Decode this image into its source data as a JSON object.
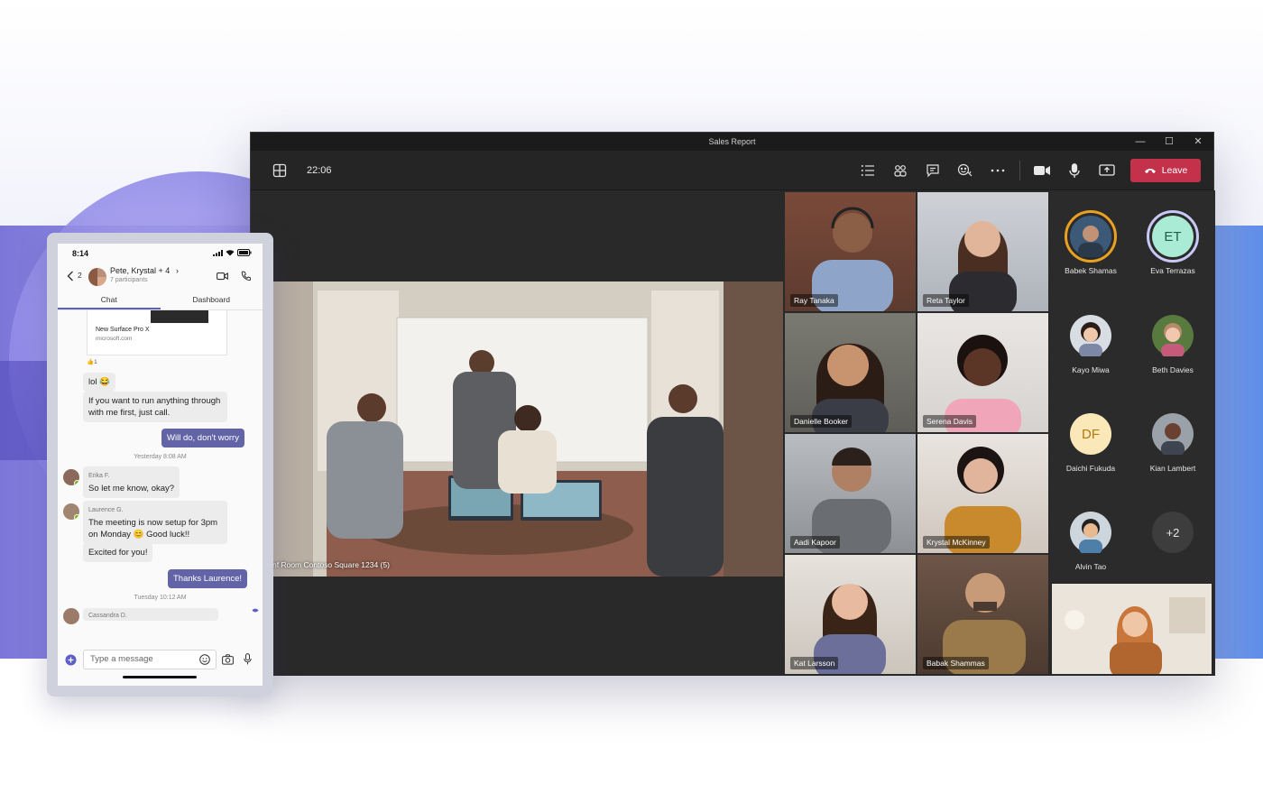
{
  "window": {
    "title": "Sales Report",
    "controls": {
      "minimize": "—",
      "maximize": "☐",
      "close": "✕"
    }
  },
  "toolbar": {
    "time": "22:06",
    "leave_label": "Leave",
    "leave_color": "#c4314b",
    "icons": [
      "grid-layout-icon",
      "participants-list-icon",
      "people-icon",
      "chat-icon",
      "reactions-icon",
      "more-options-icon",
      "camera-icon",
      "microphone-icon",
      "share-screen-icon",
      "phone-hangup-icon"
    ]
  },
  "main_video": {
    "caption": "nf Room Contoso Square 1234 (5)"
  },
  "tiles": [
    {
      "name": "Ray Tanaka"
    },
    {
      "name": "Reta Taylor"
    },
    {
      "name": "Danielle Booker"
    },
    {
      "name": "Serena Davis"
    },
    {
      "name": "Aadi Kapoor"
    },
    {
      "name": "Krystal McKinney"
    },
    {
      "name": "Kat Larsson"
    },
    {
      "name": "Babak Shammas"
    }
  ],
  "roster": [
    {
      "name": "Babek Shamas",
      "initials": "",
      "ring_color": "#e8a123"
    },
    {
      "name": "Eva Terrazas",
      "initials": "ET",
      "ring_color": "#c7c8f5"
    },
    {
      "name": "Kayo Miwa",
      "initials": ""
    },
    {
      "name": "Beth Davies",
      "initials": ""
    },
    {
      "name": "Daichi Fukuda",
      "initials": "DF"
    },
    {
      "name": "Kian Lambert",
      "initials": ""
    },
    {
      "name": "Alvin Tao",
      "initials": ""
    },
    {
      "name": "",
      "initials": "+2"
    }
  ],
  "phone": {
    "status_time": "8:14",
    "back_count": "2",
    "chat_title": "Pete, Krystal + 4",
    "chat_subtitle": "7 participants",
    "tabs": [
      "Chat",
      "Dashboard"
    ],
    "link_card": {
      "title": "New Surface Pro X",
      "domain": "microsoft.com",
      "reaction": "👍1"
    },
    "messages": [
      {
        "dir": "in",
        "text": "lol 😂"
      },
      {
        "dir": "in",
        "text": "If you want to run anything through with me first, just call."
      },
      {
        "dir": "out",
        "text": "Will do, don't worry"
      },
      {
        "dir": "stamp",
        "text": "Yesterday 8:08 AM"
      },
      {
        "dir": "in",
        "sender": "Erika F.",
        "text": "So let me know, okay?"
      },
      {
        "dir": "in",
        "sender": "Laurence G.",
        "text": "The meeting is now setup for 3pm on Monday 😊 Good luck!!"
      },
      {
        "dir": "in",
        "text": "Excited for you!"
      },
      {
        "dir": "out",
        "text": "Thanks Laurence!"
      },
      {
        "dir": "stamp",
        "text": "Tuesday 10:12 AM"
      },
      {
        "dir": "in",
        "sender": "Cassandra D.",
        "text": ""
      }
    ],
    "compose_placeholder": "Type a message"
  }
}
